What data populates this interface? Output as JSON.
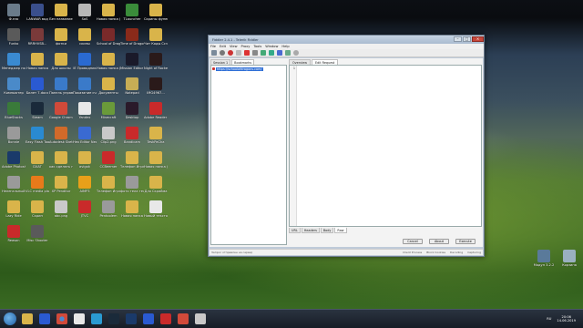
{
  "desktop": {
    "icons": [
      {
        "label": "Ф.нзо",
        "color": "#6a7b8a"
      },
      {
        "label": "LANWAR&nbsp;вод",
        "color": "#3a4f8c"
      },
      {
        "label": "Без название",
        "color": "#d9b44a"
      },
      {
        "label": "SoS",
        "color": "#b7b7b7"
      },
      {
        "label": "Новая папка (2)",
        "color": "#d9b44a"
      },
      {
        "label": "TLauncher",
        "color": "#3a8c3a"
      },
      {
        "label": "Скрины фуней",
        "color": "#d9b44a"
      },
      {
        "label": "Funko",
        "color": "#5a5a5a"
      },
      {
        "label": "RRRHVSB...",
        "color": "#7a3a3a"
      },
      {
        "label": "фотки",
        "color": "#d9b44a"
      },
      {
        "label": "скины",
        "color": "#d9b44a"
      },
      {
        "label": "School of Dragons",
        "color": "#7a2a2a"
      },
      {
        "label": "Time of Dragons",
        "color": "#8a2a1a"
      },
      {
        "label": "Чит Коды Ссз",
        "color": "#d9b44a"
      },
      {
        "label": "Менеджер по загрузкам",
        "color": "#3a8ad1"
      },
      {
        "label": "Новая папка",
        "color": "#d9b44a"
      },
      {
        "label": "Для школы",
        "color": "#d9b44a"
      },
      {
        "label": "IE Проводник",
        "color": "#2a6ad1"
      },
      {
        "label": "Новая папка (3)",
        "color": "#d9b44a"
      },
      {
        "label": "Mission Editor 2.0 Plus",
        "color": "#1a1a2a"
      },
      {
        "label": "Night of Rockefeller",
        "color": "#2a1a1a"
      },
      {
        "label": "Компьютер",
        "color": "#4a8ac9"
      },
      {
        "label": "Билет 7.docx",
        "color": "#2a5ad1"
      },
      {
        "label": "Панель управления",
        "color": "#3a7ac9"
      },
      {
        "label": "Показание счетчиков",
        "color": "#3a7ac9"
      },
      {
        "label": "Документы",
        "color": "#d9b44a"
      },
      {
        "label": "Notepad",
        "color": "#c7ad55"
      },
      {
        "label": "IMG4967...",
        "color": "#2a1a1a"
      },
      {
        "label": "BlueStacks",
        "color": "#3a7a3a"
      },
      {
        "label": "Steam",
        "color": "#1a2a3a"
      },
      {
        "label": "Google Chrome",
        "color": "#d14a3a"
      },
      {
        "label": "Yandex",
        "color": "#e8e8e8"
      },
      {
        "label": "Minecraft",
        "color": "#6a9a3a"
      },
      {
        "label": "Desktop",
        "color": "#2a1a2a"
      },
      {
        "label": "Adobe Reader X",
        "color": "#c92a2a"
      },
      {
        "label": "Bonnie",
        "color": "#9a9a9a"
      },
      {
        "label": "Easy Flash Tool 3.81",
        "color": "#2a8ad1"
      },
      {
        "label": "Autodesk SketchBook",
        "color": "#d16a2a"
      },
      {
        "label": "Hex Editor Neo",
        "color": "#3a6ad1"
      },
      {
        "label": "Clip2.png",
        "color": "#c9c9c9"
      },
      {
        "label": "Bandicam",
        "color": "#c92a2a"
      },
      {
        "label": "TeskPaCha",
        "color": "#d9b44a"
      },
      {
        "label": "Adobe Photoshop",
        "color": "#1a3a6a"
      },
      {
        "label": "DXAT",
        "color": "#d9b44a"
      },
      {
        "label": "как сделать привычное...",
        "color": "#d9b44a"
      },
      {
        "label": "avigok",
        "color": "#d9b44a"
      },
      {
        "label": "CCBeemer",
        "color": "#c92a2a"
      },
      {
        "label": "Телефон Игры",
        "color": "#d9b44a"
      },
      {
        "label": "Новая папка (4)",
        "color": "#d9b44a"
      },
      {
        "label": "Нелегальный 2019.gif",
        "color": "#9a9a9a"
      },
      {
        "label": "VLC media player",
        "color": "#e87a1a"
      },
      {
        "label": "XP Penditor",
        "color": "#d9b44a"
      },
      {
        "label": "AIMP3",
        "color": "#e8a01a"
      },
      {
        "label": "Телефон Игры",
        "color": "#d9b44a"
      },
      {
        "label": "фото тела тели",
        "color": "#9a9a9a"
      },
      {
        "label": "Для Скрайма",
        "color": "#d9b44a"
      },
      {
        "label": "Lazy Ride",
        "color": "#d9b44a"
      },
      {
        "label": "Скрин",
        "color": "#d9b44a"
      },
      {
        "label": "abc.png",
        "color": "#c9c9c9"
      },
      {
        "label": "JTVC",
        "color": "#c92a2a"
      },
      {
        "label": "Pentoolem",
        "color": "#9a9a9a"
      },
      {
        "label": "Новая папка",
        "color": "#d9b44a"
      },
      {
        "label": "Новый текстовый",
        "color": "#e8e8e8"
      },
      {
        "label": "Reason",
        "color": "#c92a2a"
      },
      {
        "label": "Misc Shooter",
        "color": "#5a5a5a"
      }
    ],
    "right_icons": [
      {
        "label": "Модул 3.2.2",
        "color": "#5a7a9a"
      },
      {
        "label": "Корзина",
        "color": "#9ab0c0"
      }
    ]
  },
  "window": {
    "title": "Fiddler 2.4.1 - Telerik Fiddler",
    "menu": [
      "File",
      "Edit",
      "View",
      "Proxy",
      "Tools",
      "Window",
      "Help"
    ],
    "left_tabs": [
      "Session 1",
      "Bookmarks"
    ],
    "tree_item": "https://schoolofdragons.com/",
    "right_tabs": [
      "Overview",
      "Edit Request"
    ],
    "line_number": "1",
    "bottom_tabs": [
      "URL",
      "Headers",
      "Body",
      "Raw"
    ],
    "buttons": {
      "cancel": "Cancel",
      "about": "About",
      "execute": "Execute"
    },
    "status_text": "Запрос отправлен на сервер",
    "status_right": [
      "Client Process",
      "Block Cookies",
      "Decoding",
      "Capturing"
    ]
  },
  "taskbar": {
    "lang": "RU",
    "time": "20:06",
    "date": "14.06.2019"
  }
}
